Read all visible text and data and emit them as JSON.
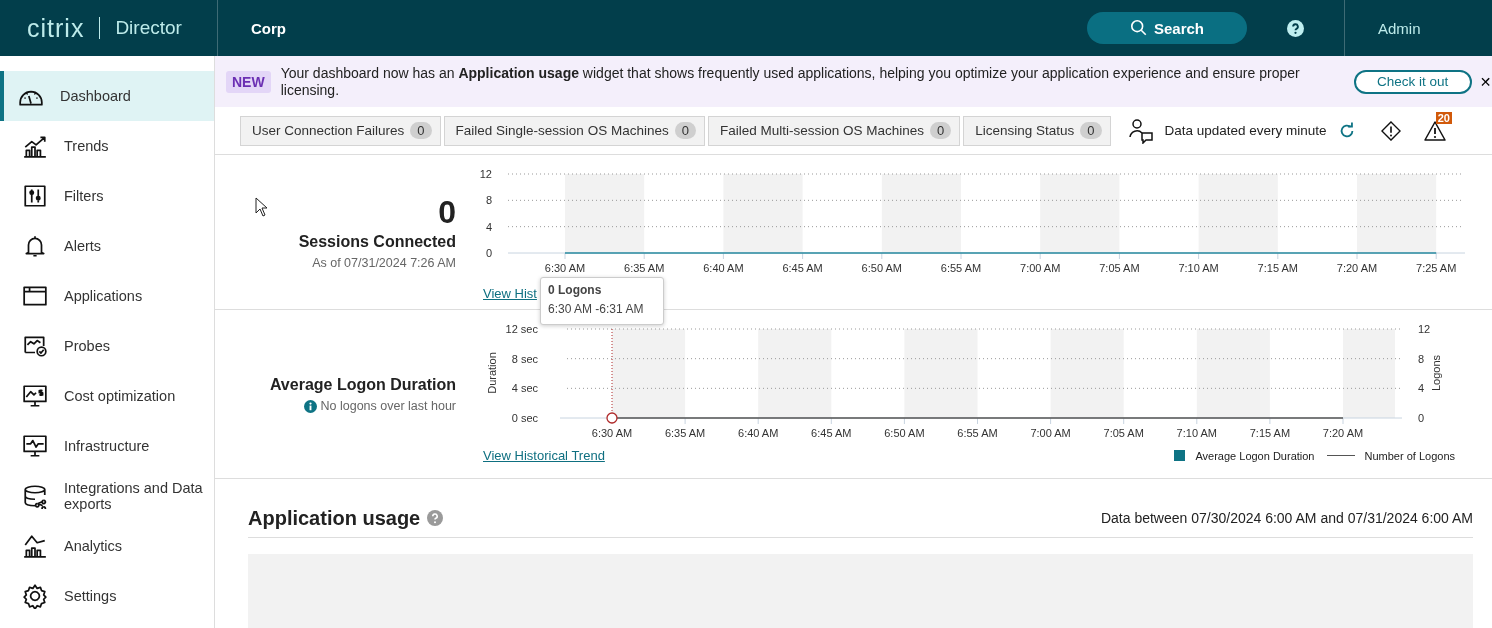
{
  "header": {
    "logo": "citrix",
    "product": "Director",
    "site": "Corp",
    "search_button": "Search",
    "user": "Admin"
  },
  "sidebar": {
    "items": [
      {
        "label": "Dashboard",
        "selected": true
      },
      {
        "label": "Trends",
        "selected": false
      },
      {
        "label": "Filters",
        "selected": false
      },
      {
        "label": "Alerts",
        "selected": false
      },
      {
        "label": "Applications",
        "selected": false
      },
      {
        "label": "Probes",
        "selected": false
      },
      {
        "label": "Cost optimization",
        "selected": false
      },
      {
        "label": "Infrastructure",
        "selected": false
      },
      {
        "label": "Integrations and Data exports",
        "selected": false
      },
      {
        "label": "Analytics",
        "selected": false
      },
      {
        "label": "Settings",
        "selected": false
      }
    ]
  },
  "banner": {
    "badge": "NEW",
    "message": "Your dashboard now has an **Application usage** widget that shows frequently used applications, helping you optimize your application experience and ensure proper licensing.",
    "button": "Check it out",
    "close": "✕"
  },
  "status_tabs": [
    {
      "label": "User Connection Failures",
      "count": "0"
    },
    {
      "label": "Failed Single-session OS Machines",
      "count": "0"
    },
    {
      "label": "Failed Multi-session OS Machines",
      "count": "0"
    },
    {
      "label": "Licensing Status",
      "count": "0"
    }
  ],
  "toolbar": {
    "update_text": "Data updated every minute",
    "alert_count": "20"
  },
  "sessions": {
    "count": "0",
    "title": "Sessions Connected",
    "as_of": "As of 07/31/2024 7:26 AM",
    "link": "View Hist",
    "chart_data": {
      "type": "line",
      "categories": [
        "6:30 AM",
        "6:35 AM",
        "6:40 AM",
        "6:45 AM",
        "6:50 AM",
        "6:55 AM",
        "7:00 AM",
        "7:05 AM",
        "7:10 AM",
        "7:15 AM",
        "7:20 AM",
        "7:25 AM"
      ],
      "yticks": [
        0,
        4,
        8,
        12
      ],
      "ylim": [
        0,
        12
      ],
      "series": [
        {
          "color": "#2a8ba0",
          "values": [
            0,
            0,
            0,
            0,
            0,
            0,
            0,
            0,
            0,
            0,
            0,
            0
          ]
        }
      ]
    }
  },
  "logon": {
    "title": "Average Logon Duration",
    "note": "No logons over last hour",
    "link": "View Historical Trend",
    "legend": [
      {
        "label": "Average Logon Duration",
        "kind": "swatch",
        "color": "#0e7384"
      }
    ],
    "tooltip": {
      "title": "0 Logons",
      "range": "6:30 AM -6:31 AM"
    },
    "chart_data": {
      "type": "line",
      "categories": [
        "6:30 AM",
        "6:35 AM",
        "6:40 AM",
        "6:45 AM",
        "6:50 AM",
        "6:55 AM",
        "7:00 AM",
        "7:05 AM",
        "7:10 AM",
        "7:15 AM",
        "7:20 AM"
      ],
      "ylabel": "Duration",
      "yticks": [
        {
          "value": 0,
          "label": "0 sec"
        },
        {
          "value": 4,
          "label": "4 sec"
        },
        {
          "value": 8,
          "label": "8 sec"
        },
        {
          "value": 12,
          "label": "12 sec"
        }
      ],
      "ylim": [
        0,
        12
      ],
      "y2label": "Logons",
      "y2ticks": [
        0,
        4,
        8,
        12
      ],
      "y2lim": [
        0,
        12
      ],
      "series": [
        {
          "name": "Number of Logons",
          "color": "#555555",
          "values": [
            0,
            0,
            0,
            0,
            0,
            0,
            0,
            0,
            0,
            0,
            0
          ]
        }
      ]
    }
  },
  "app_usage": {
    "title": "Application usage",
    "range": "Data between 07/30/2024 6:00 AM and 07/31/2024 6:00 AM"
  }
}
